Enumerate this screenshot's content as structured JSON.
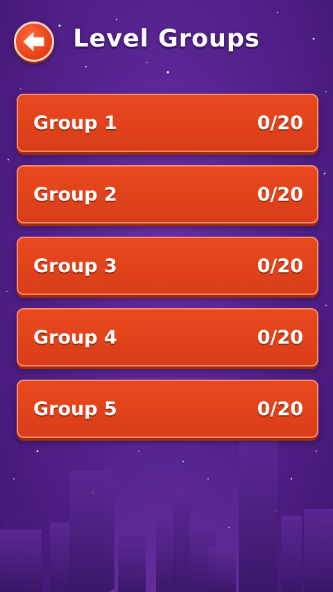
{
  "header": {
    "title": "Level Groups",
    "back_icon": "back-arrow-icon"
  },
  "groups": [
    {
      "name": "Group 1",
      "progress": "0/20"
    },
    {
      "name": "Group 2",
      "progress": "0/20"
    },
    {
      "name": "Group 3",
      "progress": "0/20"
    },
    {
      "name": "Group 4",
      "progress": "0/20"
    },
    {
      "name": "Group 5",
      "progress": "0/20"
    }
  ],
  "colors": {
    "background": "#55238f",
    "card": "#e2431b",
    "card_border": "#ff8a68",
    "text": "#ffffff"
  }
}
